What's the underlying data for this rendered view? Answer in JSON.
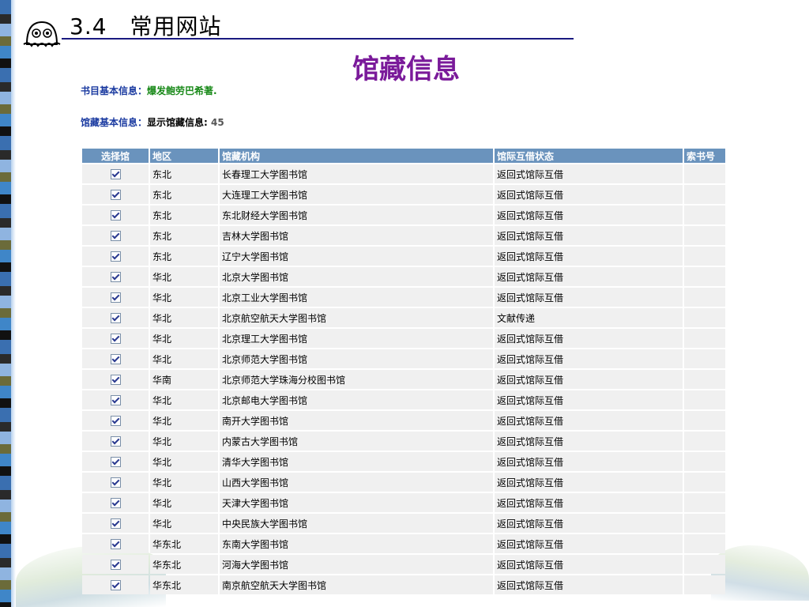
{
  "slide": {
    "title": "3.4　常用网站"
  },
  "page": {
    "heading": "馆藏信息",
    "book_info_label": "书目基本信息：",
    "book_info_value": "爆发鲍劳巴希著.",
    "holding_info_label": "馆藏基本信息：",
    "holding_info_value": "显示馆藏信息:",
    "holding_count": "45"
  },
  "table": {
    "headers": {
      "select": "选择馆",
      "region": "地区",
      "institution": "馆藏机构",
      "ill_status": "馆际互借状态",
      "call_number": "索书号"
    },
    "rows": [
      {
        "region": "东北",
        "institution": "长春理工大学图书馆",
        "status": "返回式馆际互借",
        "call": ""
      },
      {
        "region": "东北",
        "institution": "大连理工大学图书馆",
        "status": "返回式馆际互借",
        "call": ""
      },
      {
        "region": "东北",
        "institution": "东北财经大学图书馆",
        "status": "返回式馆际互借",
        "call": ""
      },
      {
        "region": "东北",
        "institution": "吉林大学图书馆",
        "status": "返回式馆际互借",
        "call": ""
      },
      {
        "region": "东北",
        "institution": "辽宁大学图书馆",
        "status": "返回式馆际互借",
        "call": ""
      },
      {
        "region": "华北",
        "institution": "北京大学图书馆",
        "status": "返回式馆际互借",
        "call": ""
      },
      {
        "region": "华北",
        "institution": "北京工业大学图书馆",
        "status": "返回式馆际互借",
        "call": ""
      },
      {
        "region": "华北",
        "institution": "北京航空航天大学图书馆",
        "status": "文献传递",
        "call": ""
      },
      {
        "region": "华北",
        "institution": "北京理工大学图书馆",
        "status": "返回式馆际互借",
        "call": ""
      },
      {
        "region": "华北",
        "institution": "北京师范大学图书馆",
        "status": "返回式馆际互借",
        "call": ""
      },
      {
        "region": "华南",
        "institution": "北京师范大学珠海分校图书馆",
        "status": "返回式馆际互借",
        "call": ""
      },
      {
        "region": "华北",
        "institution": "北京邮电大学图书馆",
        "status": "返回式馆际互借",
        "call": ""
      },
      {
        "region": "华北",
        "institution": "南开大学图书馆",
        "status": "返回式馆际互借",
        "call": ""
      },
      {
        "region": "华北",
        "institution": "内蒙古大学图书馆",
        "status": "返回式馆际互借",
        "call": ""
      },
      {
        "region": "华北",
        "institution": "清华大学图书馆",
        "status": "返回式馆际互借",
        "call": ""
      },
      {
        "region": "华北",
        "institution": "山西大学图书馆",
        "status": "返回式馆际互借",
        "call": ""
      },
      {
        "region": "华北",
        "institution": "天津大学图书馆",
        "status": "返回式馆际互借",
        "call": ""
      },
      {
        "region": "华北",
        "institution": "中央民族大学图书馆",
        "status": "返回式馆际互借",
        "call": ""
      },
      {
        "region": "华东北",
        "institution": "东南大学图书馆",
        "status": "返回式馆际互借",
        "call": ""
      },
      {
        "region": "华东北",
        "institution": "河海大学图书馆",
        "status": "返回式馆际互借",
        "call": ""
      },
      {
        "region": "华东北",
        "institution": "南京航空航天大学图书馆",
        "status": "返回式馆际互借",
        "call": ""
      }
    ]
  }
}
